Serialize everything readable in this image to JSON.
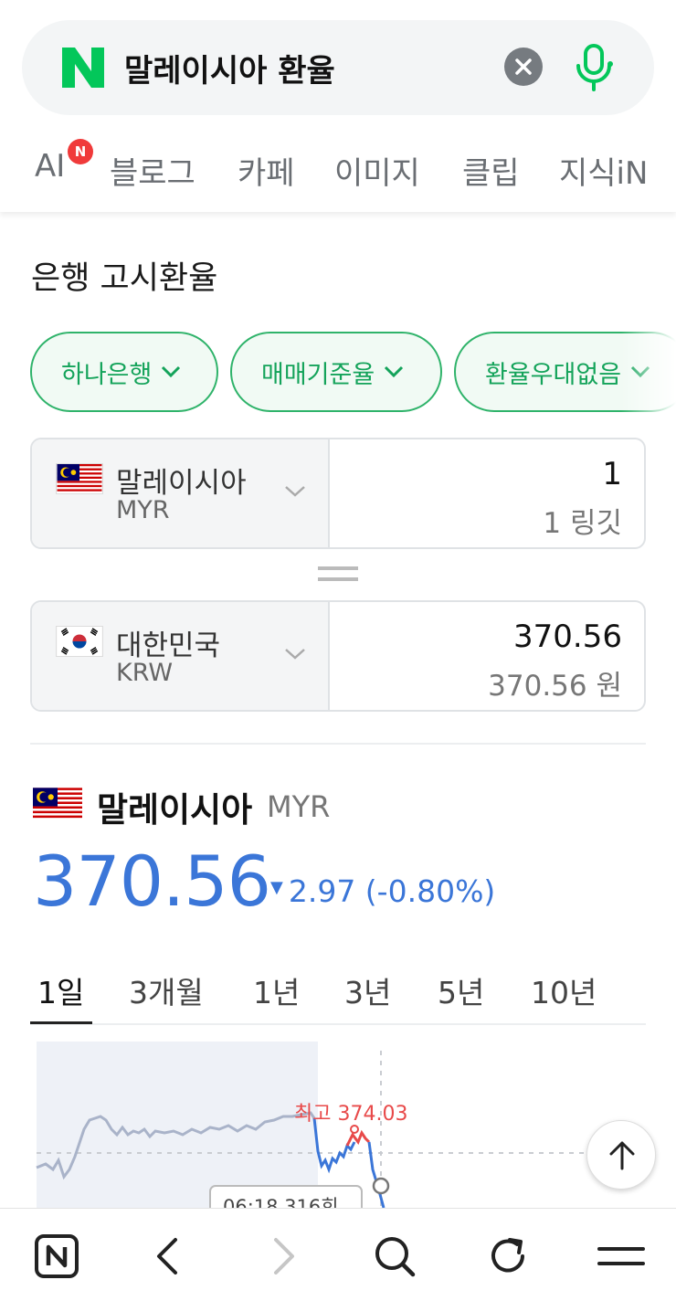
{
  "search": {
    "logo_letter": "N",
    "query": "말레이시아 환율"
  },
  "tabs": [
    {
      "label": "AI",
      "badge": "N"
    },
    {
      "label": "블로그"
    },
    {
      "label": "카페"
    },
    {
      "label": "이미지"
    },
    {
      "label": "클립"
    },
    {
      "label": "지식iN"
    }
  ],
  "exchange": {
    "section_title": "은행 고시환율",
    "filters": [
      "하나은행",
      "매매기준율",
      "환율우대없음"
    ],
    "from": {
      "name": "말레이시아",
      "code": "MYR",
      "amount": "1",
      "amount_text": "1 링깃"
    },
    "to": {
      "name": "대한민국",
      "code": "KRW",
      "amount": "370.56",
      "amount_text": "370.56 원"
    }
  },
  "rate": {
    "name": "말레이시아",
    "code": "MYR",
    "value": "370.56",
    "change": "2.97 (-0.80%)",
    "change_direction": "down",
    "color": "#3b76d8"
  },
  "periods": [
    "1일",
    "3개월",
    "1년",
    "3년",
    "5년",
    "10년"
  ],
  "active_period": "1일",
  "chart_data": {
    "type": "line",
    "annotation_high": "최고 374.03",
    "tooltip": "06:18  316회"
  },
  "colors": {
    "brand_green": "#03c75a",
    "accent_blue": "#3b76d8",
    "high_red": "#e84a4a"
  },
  "bottom_nav": [
    "home-icon",
    "back-icon",
    "forward-icon",
    "search-icon",
    "refresh-icon",
    "menu-icon"
  ]
}
